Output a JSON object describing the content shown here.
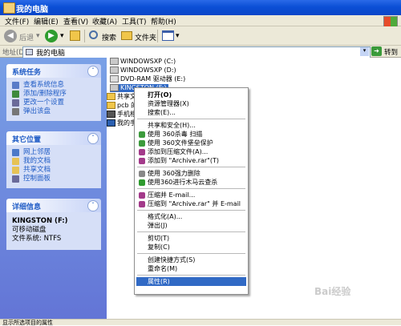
{
  "window": {
    "title": "我的电脑"
  },
  "menubar": {
    "items": [
      "文件(F)",
      "编辑(E)",
      "查看(V)",
      "收藏(A)",
      "工具(T)",
      "帮助(H)"
    ]
  },
  "toolbar": {
    "back": "后退",
    "search": "搜索",
    "folders": "文件夹"
  },
  "address": {
    "label": "地址(D)",
    "value": "我的电脑",
    "go": "转到"
  },
  "sidebar": {
    "system_tasks": {
      "title": "系统任务",
      "items": [
        "查看系统信息",
        "添加/删除程序",
        "更改一个设置",
        "弹出该盘"
      ]
    },
    "other_places": {
      "title": "其它位置",
      "items": [
        "网上邻居",
        "我的文档",
        "共享文档",
        "控制面板"
      ]
    },
    "details": {
      "title": "详细信息",
      "name": "KINGSTON (F:)",
      "type": "可移动磁盘",
      "fs": "文件系统: NTFS"
    }
  },
  "drives": [
    "WINDOWSXP (C:)",
    "WINDOWSXP (D:)",
    "DVD-RAM 驱动器 (E:)",
    "KINGSTON (F:)",
    "共享文档",
    "pcb 的文",
    "手机相册",
    "我的手机"
  ],
  "context_menu": {
    "items": [
      {
        "label": "打开(O)",
        "bold": true
      },
      {
        "label": "资源管理器(X)"
      },
      {
        "label": "搜索(E)..."
      },
      {
        "sep": true
      },
      {
        "label": "共享和安全(H)..."
      },
      {
        "label": "使用 360杀毒 扫描",
        "icon": "#3c9b3c"
      },
      {
        "label": "使用 360文件堡垒保护",
        "icon": "#3c9b3c"
      },
      {
        "label": "添加到压缩文件(A)...",
        "icon": "#a33a8a"
      },
      {
        "label": "添加到 \"Archive.rar\"(T)",
        "icon": "#a33a8a"
      },
      {
        "sep": true
      },
      {
        "label": "使用 360强力删除",
        "icon": "#888888"
      },
      {
        "label": "使用360进行木马云查杀",
        "icon": "#2f9b2f"
      },
      {
        "sep": true
      },
      {
        "label": "压缩并 E-mail...",
        "icon": "#a33a8a"
      },
      {
        "label": "压缩到 \"Archive.rar\" 并 E-mail",
        "icon": "#a33a8a"
      },
      {
        "sep": true
      },
      {
        "label": "格式化(A)..."
      },
      {
        "label": "弹出(J)"
      },
      {
        "sep": true
      },
      {
        "label": "剪切(T)"
      },
      {
        "label": "复制(C)"
      },
      {
        "sep": true
      },
      {
        "label": "创建快捷方式(S)"
      },
      {
        "label": "重命名(M)"
      },
      {
        "sep": true
      },
      {
        "label": "属性(R)",
        "selected": true
      }
    ]
  },
  "statusbar": {
    "text": "显示所选项目的属性"
  },
  "watermark": "Bai经验"
}
